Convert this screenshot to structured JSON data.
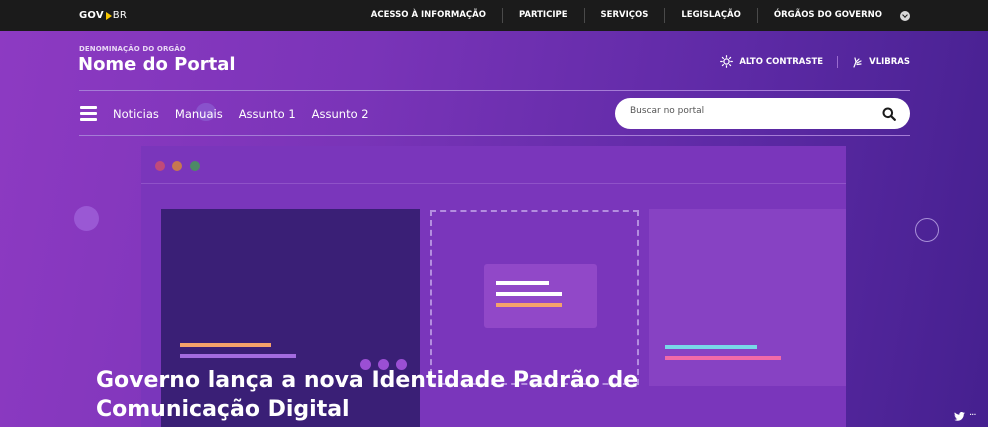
{
  "gov_bar": {
    "logo_gov": "GOV",
    "logo_br": "BR",
    "links": [
      "ACESSO À INFORMAÇÃO",
      "PARTICIPE",
      "SERVIÇOS",
      "LEGISLAÇÃO",
      "ÓRGÃOS DO GOVERNO"
    ]
  },
  "header": {
    "org_name": "DENOMINAÇÃO DO ORGÃO",
    "portal_name": "Nome do Portal",
    "high_contrast_label": "ALTO CONTRASTE",
    "vlibras_label": "VLIBRAS"
  },
  "nav": {
    "items": [
      "Noticias",
      "Manuais",
      "Assunto 1",
      "Assunto 2"
    ]
  },
  "search": {
    "placeholder": "Buscar no portal"
  },
  "hero": {
    "headline": "Governo lança a nova Identidade Padrão de Comunicação Digital",
    "share_more": "···"
  },
  "icons": {
    "logo_arrow": "arrow-icon",
    "dropdown": "chevron-down-icon",
    "contrast": "sun-icon",
    "vlibras": "hand-icon",
    "menu": "hamburger-icon",
    "search": "search-icon",
    "twitter": "twitter-icon"
  },
  "colors": {
    "gov_bar": "#1b1b1b",
    "hero_start": "#8d3ac2",
    "hero_end": "#45208f",
    "logo_arrow": "#f7c600",
    "bar_orange": "#f5a26a",
    "bar_purple": "#a36be0",
    "bar_cyan": "#78d8e8",
    "bar_pink": "#f06aa8",
    "window_dot_red": "#c04a7a",
    "window_dot_orange": "#c7784f",
    "window_dot_green": "#4d8a66"
  }
}
